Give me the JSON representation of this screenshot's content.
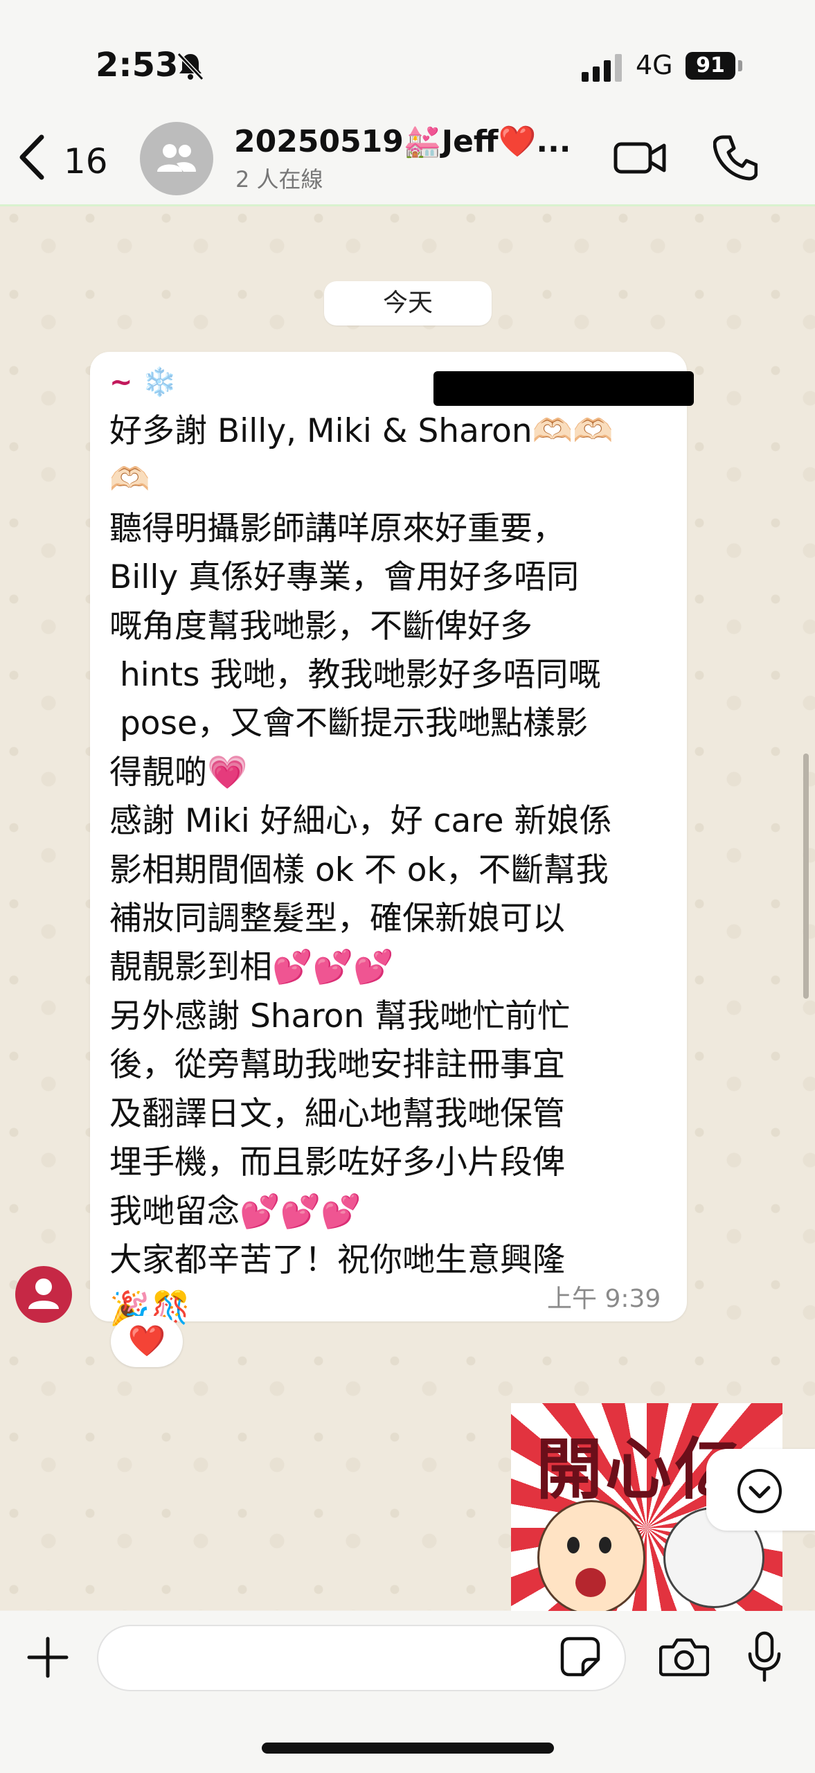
{
  "status_bar": {
    "time": "2:53",
    "network": "4G",
    "battery": "91",
    "icons": [
      "bell-slash-icon",
      "signal-icon"
    ]
  },
  "header": {
    "back_count": "16",
    "title": "20250519💒Jeff❤️...",
    "subtitle": "2 人在線",
    "icons": [
      "chevron-left-icon",
      "group-avatar-icon",
      "video-call-icon",
      "phone-call-icon"
    ]
  },
  "chat": {
    "date_chip": "今天",
    "message": {
      "sender": "~ ❄️",
      "text": "好多謝 Billy, Miki & Sharon🫶🏻🫶🏻\n🫶🏻\n聽得明攝影師講咩原來好重要，\nBilly 真係好專業，會用好多唔同\n嘅角度幫我哋影，不斷俾好多\n hints 我哋，教我哋影好多唔同嘅\n pose，又會不斷提示我哋點樣影\n得靚啲💗\n感謝 Miki 好細心，好 care 新娘係\n影相期間個樣 ok 不 ok，不斷幫我\n補妝同調整髮型，確保新娘可以\n靚靚影到相💕💕💕\n另外感謝 Sharon 幫我哋忙前忙\n後，從旁幫助我哋安排註冊事宜\n及翻譯日文，細心地幫我哋保管\n埋手機，而且影咗好多小片段俾\n我哋留念💕💕💕\n大家都辛苦了！祝你哋生意興隆\n🎉🎊",
      "time": "上午 9:39",
      "reaction": "❤️"
    },
    "sticker": {
      "text": "開心亿",
      "badge": "cow"
    }
  },
  "input_bar": {
    "placeholder": "",
    "icons": [
      "plus-icon",
      "sticker-icon",
      "camera-icon",
      "microphone-icon"
    ]
  },
  "colors": {
    "sender": "#c2185b",
    "reaction": "#d91c26",
    "avatar": "#c62845"
  }
}
